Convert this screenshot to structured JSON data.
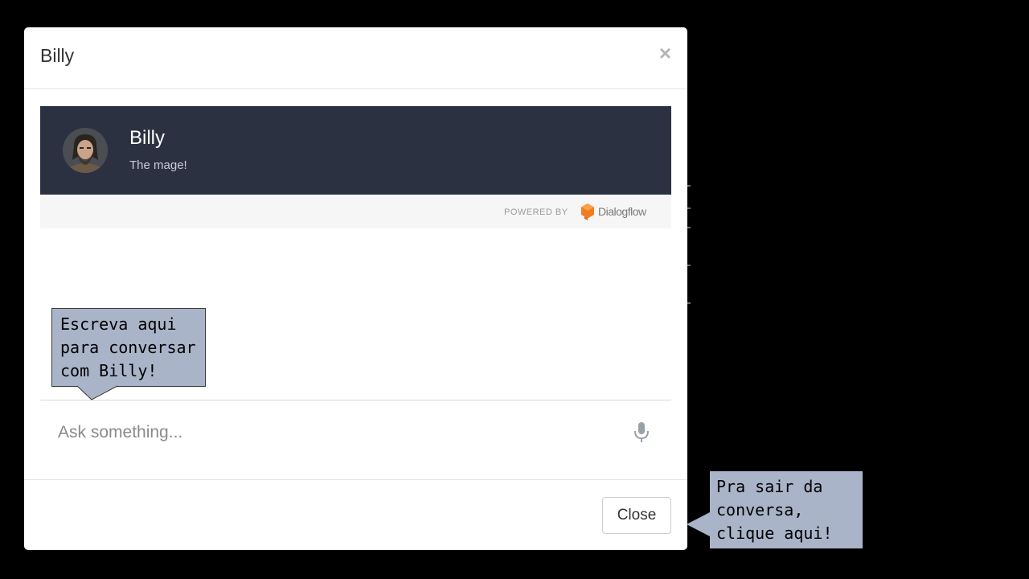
{
  "modal": {
    "title": "Billy",
    "close_icon": "close-icon"
  },
  "agent": {
    "name": "Billy",
    "description": "The mage!",
    "avatar_icon": "avatar-bearded-mage"
  },
  "branding": {
    "powered_by": "POWERED BY",
    "logo_text": "Dialogflow",
    "logo_color": "#f47c20"
  },
  "input": {
    "placeholder": "Ask something...",
    "value": "",
    "mic_icon": "microphone-icon"
  },
  "footer": {
    "close_label": "Close"
  },
  "callouts": {
    "write_hint": [
      "Escreva aqui",
      "para conversar",
      "com Billy!"
    ],
    "exit_hint": [
      "Pra sair da",
      "conversa,",
      "clique aqui!"
    ],
    "color": "#aab4c8"
  },
  "colors": {
    "background": "#000000",
    "agent_card": "#2c3142",
    "powered_bar": "#f6f6f6"
  }
}
